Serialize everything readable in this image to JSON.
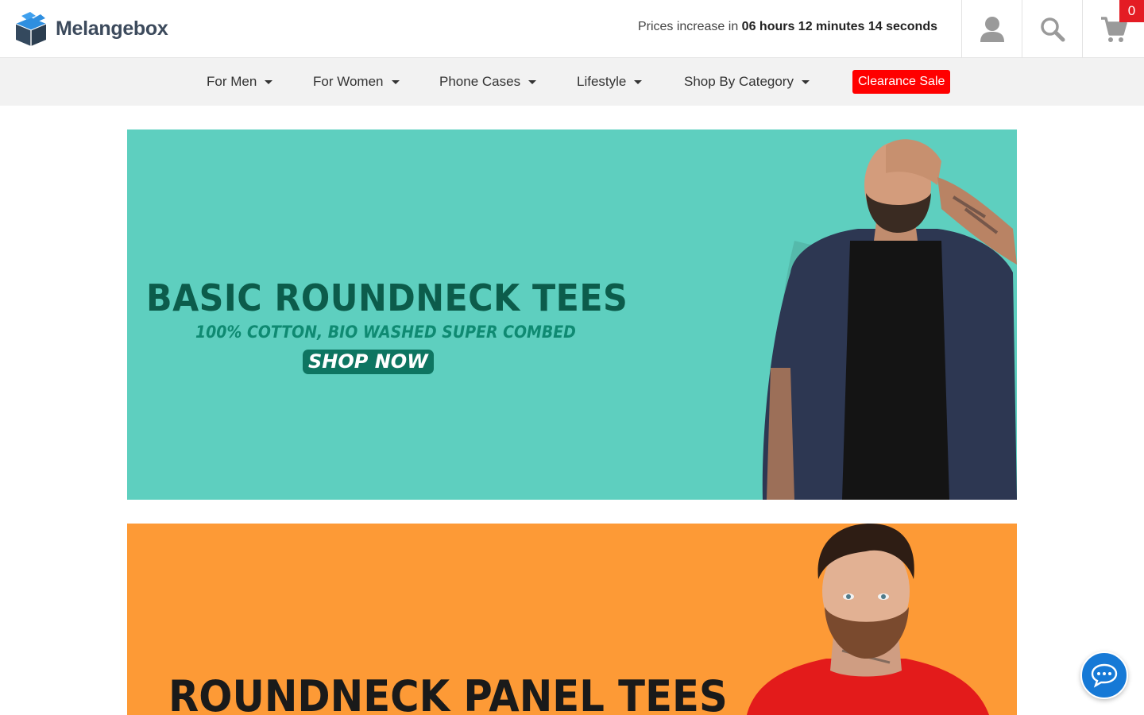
{
  "brand": {
    "name": "Melangebox"
  },
  "countdown": {
    "prefix": "Prices increase in",
    "time": "06 hours 12 minutes 14 seconds"
  },
  "header_icons": {
    "account": "user-icon",
    "search": "search-icon",
    "cart": "cart-icon"
  },
  "cart": {
    "count": "0"
  },
  "nav": {
    "items": [
      {
        "label": "For Men"
      },
      {
        "label": "For Women"
      },
      {
        "label": "Phone Cases"
      },
      {
        "label": "Lifestyle"
      },
      {
        "label": "Shop By Category"
      }
    ],
    "clearance": "Clearance Sale"
  },
  "banners": [
    {
      "title": "BASIC ROUNDNECK TEES",
      "subtitle": "100% COTTON, BIO WASHED SUPER COMBED",
      "cta": "SHOP NOW",
      "color": "#5ecfbf"
    },
    {
      "title": "ROUNDNECK PANEL TEES",
      "color": "#fd9a36"
    }
  ],
  "colors": {
    "accent_red": "#ff0000",
    "chat_blue": "#1679d6"
  }
}
